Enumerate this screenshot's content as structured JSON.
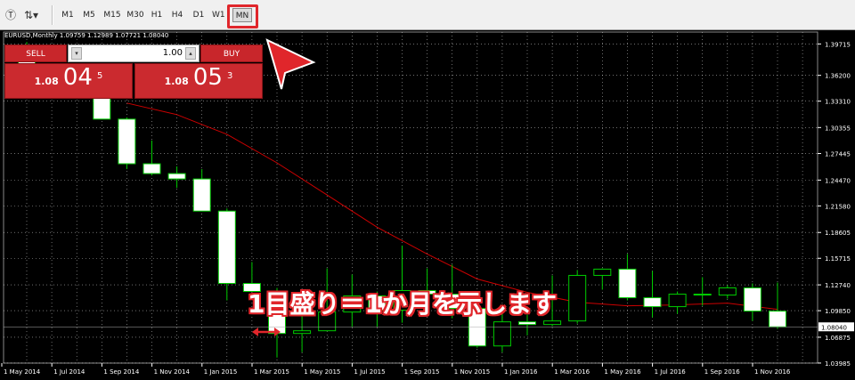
{
  "toolbar": {
    "timeframes": [
      "M1",
      "M5",
      "M15",
      "M30",
      "H1",
      "H4",
      "D1",
      "W1",
      "MN"
    ],
    "active_timeframe": "MN",
    "icons": [
      "text-tool-icon",
      "object-tools-icon"
    ]
  },
  "chart": {
    "symbol_title": "EURUSD,Monthly  1.09759 1.12989 1.07721 1.08040",
    "bid_label": "1.08040",
    "colors": {
      "background": "#000000",
      "grid": "#ffffff",
      "candle_up": "#000000",
      "candle_down": "#ffffff",
      "wick": "#00cc00",
      "ma_line": "#cc0000",
      "accent": "#e0262b"
    }
  },
  "trade_panel": {
    "sell_label": "SELL",
    "buy_label": "BUY",
    "lot_value": "1.00",
    "sell_price": {
      "prefix": "1.08",
      "big": "04",
      "sup": "5"
    },
    "buy_price": {
      "prefix": "1.08",
      "big": "05",
      "sup": "3"
    }
  },
  "annotation": {
    "text": "1目盛り＝1か月を示します"
  },
  "chart_data": {
    "type": "candlestick",
    "x_tick_labels": [
      "1 May 2014",
      "1 Jul 2014",
      "1 Sep 2014",
      "1 Nov 2014",
      "1 Jan 2015",
      "1 Mar 2015",
      "1 May 2015",
      "1 Jul 2015",
      "1 Sep 2015",
      "1 Nov 2015",
      "1 Jan 2016",
      "1 Mar 2016",
      "1 May 2016",
      "1 Jul 2016",
      "1 Sep 2016",
      "1 Nov 2016"
    ],
    "y_tick_labels": [
      "1.39715",
      "1.36200",
      "1.33310",
      "1.30355",
      "1.27445",
      "1.24470",
      "1.21580",
      "1.18605",
      "1.15715",
      "1.12740",
      "1.09850",
      "1.06875",
      "1.03985"
    ],
    "ylim": [
      1.0398,
      1.4105
    ],
    "current_price": 1.0804,
    "candles": [
      {
        "t": "2014-05",
        "o": 1.3866,
        "h": 1.3993,
        "l": 1.358,
        "c": 1.36
      },
      {
        "t": "2014-06",
        "o": 1.36,
        "h": 1.369,
        "l": 1.3505,
        "c": 1.369
      },
      {
        "t": "2014-07",
        "o": 1.369,
        "h": 1.37,
        "l": 1.339,
        "c": 1.339
      },
      {
        "t": "2014-08",
        "o": 1.339,
        "h": 1.344,
        "l": 1.313,
        "c": 1.313
      },
      {
        "t": "2014-09",
        "o": 1.313,
        "h": 1.315,
        "l": 1.257,
        "c": 1.263
      },
      {
        "t": "2014-10",
        "o": 1.263,
        "h": 1.289,
        "l": 1.25,
        "c": 1.252
      },
      {
        "t": "2014-11",
        "o": 1.252,
        "h": 1.26,
        "l": 1.236,
        "c": 1.246
      },
      {
        "t": "2014-12",
        "o": 1.246,
        "h": 1.257,
        "l": 1.21,
        "c": 1.21
      },
      {
        "t": "2015-01",
        "o": 1.21,
        "h": 1.213,
        "l": 1.11,
        "c": 1.129
      },
      {
        "t": "2015-02",
        "o": 1.129,
        "h": 1.153,
        "l": 1.12,
        "c": 1.12
      },
      {
        "t": "2015-03",
        "o": 1.12,
        "h": 1.124,
        "l": 1.046,
        "c": 1.073
      },
      {
        "t": "2015-04",
        "o": 1.073,
        "h": 1.1,
        "l": 1.052,
        "c": 1.076
      },
      {
        "t": "2015-05",
        "o": 1.076,
        "h": 1.146,
        "l": 1.082,
        "c": 1.097
      },
      {
        "t": "2015-06",
        "o": 1.097,
        "h": 1.139,
        "l": 1.08,
        "c": 1.115
      },
      {
        "t": "2015-07",
        "o": 1.115,
        "h": 1.12,
        "l": 1.08,
        "c": 1.099
      },
      {
        "t": "2015-08",
        "o": 1.099,
        "h": 1.1715,
        "l": 1.085,
        "c": 1.121
      },
      {
        "t": "2015-09",
        "o": 1.121,
        "h": 1.146,
        "l": 1.109,
        "c": 1.117
      },
      {
        "t": "2015-10",
        "o": 1.117,
        "h": 1.15,
        "l": 1.09,
        "c": 1.101
      },
      {
        "t": "2015-11",
        "o": 1.101,
        "h": 1.108,
        "l": 1.057,
        "c": 1.059
      },
      {
        "t": "2015-12",
        "o": 1.059,
        "h": 1.105,
        "l": 1.052,
        "c": 1.086
      },
      {
        "t": "2016-01",
        "o": 1.086,
        "h": 1.099,
        "l": 1.071,
        "c": 1.083
      },
      {
        "t": "2016-02",
        "o": 1.083,
        "h": 1.138,
        "l": 1.081,
        "c": 1.087
      },
      {
        "t": "2016-03",
        "o": 1.087,
        "h": 1.144,
        "l": 1.084,
        "c": 1.138
      },
      {
        "t": "2016-04",
        "o": 1.138,
        "h": 1.146,
        "l": 1.122,
        "c": 1.145
      },
      {
        "t": "2016-05",
        "o": 1.145,
        "h": 1.162,
        "l": 1.11,
        "c": 1.113
      },
      {
        "t": "2016-06",
        "o": 1.113,
        "h": 1.143,
        "l": 1.091,
        "c": 1.103
      },
      {
        "t": "2016-07",
        "o": 1.103,
        "h": 1.12,
        "l": 1.095,
        "c": 1.117
      },
      {
        "t": "2016-08",
        "o": 1.117,
        "h": 1.136,
        "l": 1.104,
        "c": 1.116
      },
      {
        "t": "2016-09",
        "o": 1.116,
        "h": 1.127,
        "l": 1.112,
        "c": 1.124
      },
      {
        "t": "2016-10",
        "o": 1.124,
        "h": 1.129,
        "l": 1.087,
        "c": 1.098
      },
      {
        "t": "2016-11",
        "o": 1.098,
        "h": 1.13,
        "l": 1.078,
        "c": 1.0804
      }
    ],
    "moving_average": [
      {
        "t": "2014-09",
        "v": 1.331
      },
      {
        "t": "2014-11",
        "v": 1.318
      },
      {
        "t": "2015-01",
        "v": 1.296
      },
      {
        "t": "2015-03",
        "v": 1.264
      },
      {
        "t": "2015-05",
        "v": 1.228
      },
      {
        "t": "2015-07",
        "v": 1.192
      },
      {
        "t": "2015-09",
        "v": 1.162
      },
      {
        "t": "2015-11",
        "v": 1.134
      },
      {
        "t": "2016-01",
        "v": 1.119
      },
      {
        "t": "2016-03",
        "v": 1.108
      },
      {
        "t": "2016-05",
        "v": 1.104
      },
      {
        "t": "2016-07",
        "v": 1.105
      },
      {
        "t": "2016-09",
        "v": 1.107
      },
      {
        "t": "2016-11",
        "v": 1.1
      }
    ]
  }
}
